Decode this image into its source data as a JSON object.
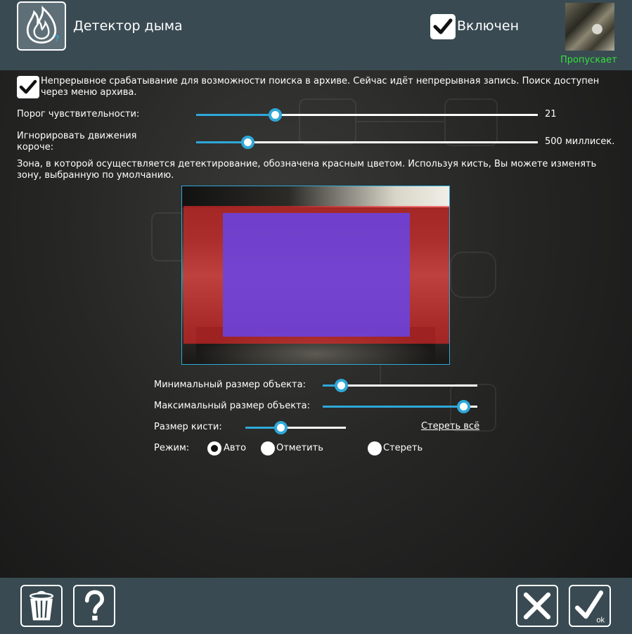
{
  "header": {
    "title": "Детектор дыма",
    "enabled_label": "Включен",
    "enabled_checked": true,
    "camera_status": "Пропускает",
    "camera_status_color": "#35e03a"
  },
  "settings": {
    "continuous_checked": true,
    "continuous_text": "Непрерывное срабатывание для возможности поиска в архиве. Сейчас идёт непрерывная запись. Поиск доступен через меню архива.",
    "sensitivity_label": "Порог чувствительности:",
    "sensitivity_value": "21",
    "sensitivity_level": 0.23,
    "ignore_label": "Игнорировать движения короче:",
    "ignore_value": "500 миллисек.",
    "ignore_level": 0.15,
    "zone_text": "Зона, в которой осуществляется детектирование, обозначена красным цветом. Используя кисть, Вы можете изменять зону, выбранную по умолчанию."
  },
  "object": {
    "min_label": "Минимальный размер объекта:",
    "min_level": 0.12,
    "max_label": "Максимальный размер объекта:",
    "max_level": 0.91,
    "brush_label": "Размер кисти:",
    "brush_level": 0.35,
    "clear_all": "Стереть всё",
    "mode_label": "Режим:",
    "modes": [
      "Авто",
      "Отметить",
      "Стереть"
    ],
    "selected_mode": "Авто"
  },
  "colors": {
    "accent": "#2fa8d8",
    "panel": "#394a52",
    "detection_zone": "#f02828",
    "selection_zone": "#6446f0"
  },
  "footer": {
    "icons": [
      "trash-icon",
      "help-icon",
      "close-icon",
      "ok-icon"
    ],
    "ok_caption": "ok"
  }
}
